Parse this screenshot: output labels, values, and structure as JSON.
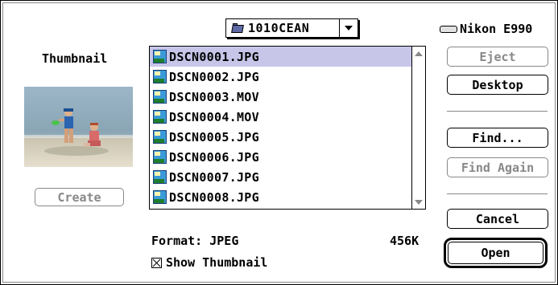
{
  "dialog": {
    "folder_popup": {
      "label": "1010CEAN",
      "icon": "folder-icon"
    },
    "volume": {
      "label": "Nikon E990",
      "icon": "disk-icon"
    },
    "thumbnail": {
      "label": "Thumbnail",
      "create_label": "Create"
    },
    "files": [
      {
        "name": "DSCN0001.JPG",
        "selected": true
      },
      {
        "name": "DSCN0002.JPG",
        "selected": false
      },
      {
        "name": "DSCN0003.MOV",
        "selected": false
      },
      {
        "name": "DSCN0004.MOV",
        "selected": false
      },
      {
        "name": "DSCN0005.JPG",
        "selected": false
      },
      {
        "name": "DSCN0006.JPG",
        "selected": false
      },
      {
        "name": "DSCN0007.JPG",
        "selected": false
      },
      {
        "name": "DSCN0008.JPG",
        "selected": false
      }
    ],
    "format_label": "Format:  JPEG",
    "file_size": "456K",
    "show_thumbnail": {
      "label": "Show Thumbnail",
      "checked": true
    },
    "buttons": {
      "eject": "Eject",
      "desktop": "Desktop",
      "find": "Find...",
      "find_again": "Find Again",
      "cancel": "Cancel",
      "open": "Open"
    },
    "colors": {
      "selection": "#c7c6e9",
      "disabled_text": "#888888"
    }
  }
}
